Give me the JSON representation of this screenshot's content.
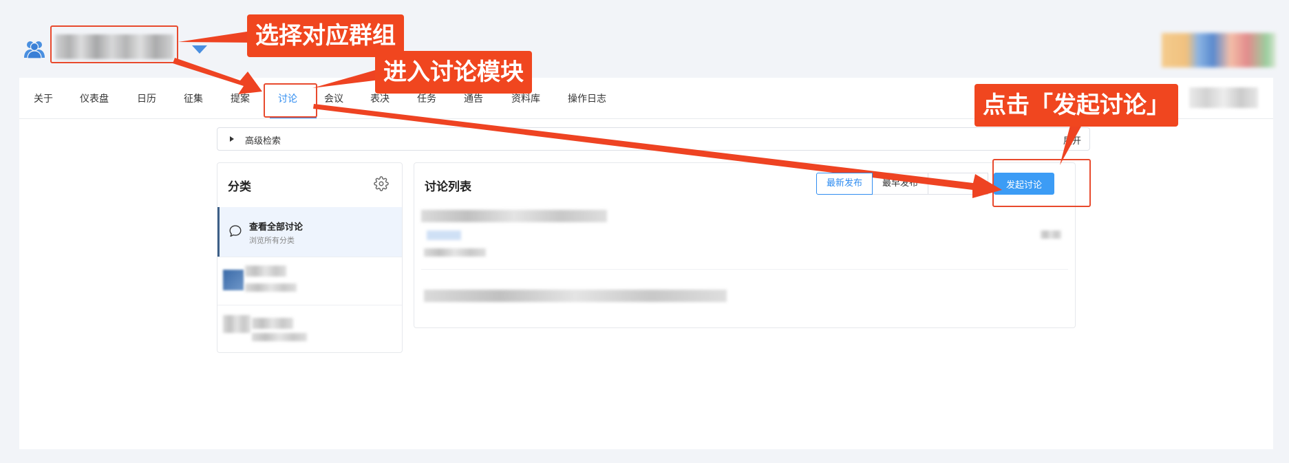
{
  "header": {
    "group_icon": "group-users-icon",
    "dropdown_icon": "caret-down-icon"
  },
  "nav": {
    "tabs": [
      "关于",
      "仪表盘",
      "日历",
      "征集",
      "提案",
      "讨论",
      "会议",
      "表决",
      "任务",
      "通告",
      "资料库",
      "操作日志"
    ],
    "active": "讨论"
  },
  "advanced_search": {
    "label": "高级检索",
    "expand": "展开"
  },
  "categories": {
    "title": "分类",
    "settings_icon": "gear-icon",
    "all": {
      "title": "查看全部讨论",
      "subtitle": "浏览所有分类",
      "icon": "chat-bubble-icon"
    }
  },
  "discussion_list": {
    "title": "讨论列表",
    "sort_newest": "最新发布",
    "sort_oldest": "最早发布",
    "start_button": "发起讨论"
  },
  "annotations": {
    "step1": "选择对应群组",
    "step2": "进入讨论模块",
    "step3": "点击「发起讨论」",
    "color": "#f0461f"
  },
  "colors": {
    "accent": "#2f8cf0",
    "primary_button": "#3c9cf5",
    "page_bg": "#f2f4f8"
  }
}
